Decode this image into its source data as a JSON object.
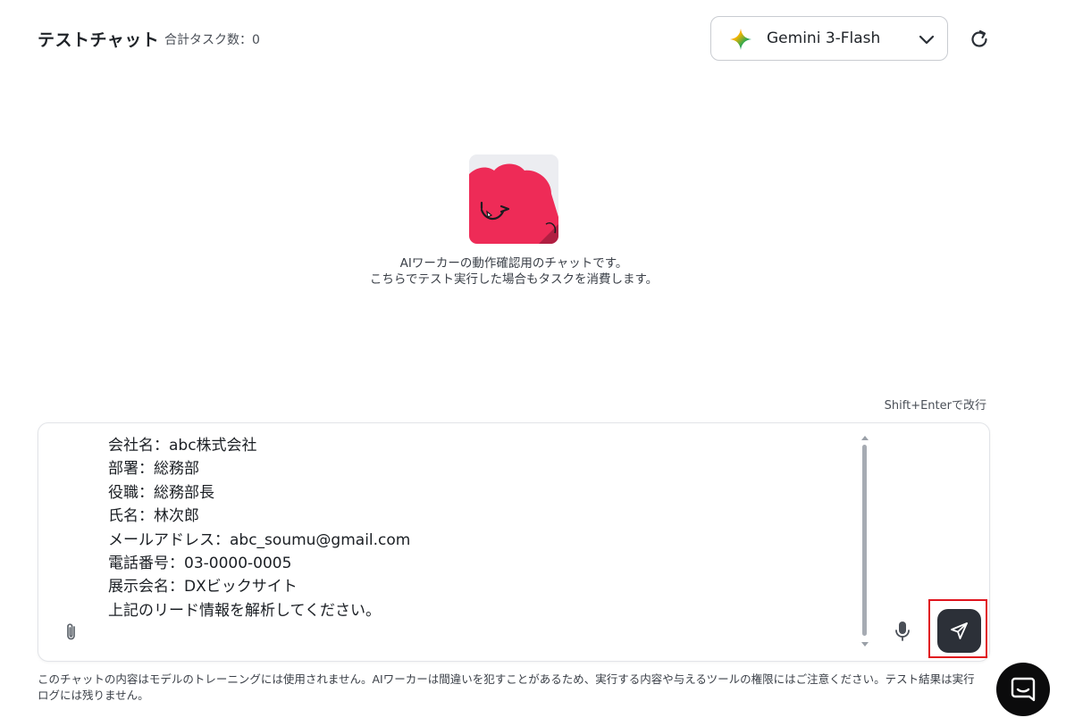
{
  "header": {
    "title": "テストチャット",
    "task_count": "合計タスク数：0"
  },
  "model_selector": {
    "selected": "Gemini 3-Flash",
    "icon": "gemini-sparkle-icon"
  },
  "intro": {
    "line1": "AIワーカーの動作確認用のチャットです。",
    "line2": "こちらでテスト実行した場合もタスクを消費します。"
  },
  "composer": {
    "hint": "Shift+Enterで改行",
    "message": "会社名：abc株式会社\n部署：総務部\n役職：総務部長\n氏名：林次郎\nメールアドレス：abc_soumu@gmail.com\n電話番号：03-0000-0005\n展示会名：DXビックサイト\n上記のリード情報を解析してください。"
  },
  "disclaimer": "このチャットの内容はモデルのトレーニングには使用されません。AIワーカーは間違いを犯すことがあるため、実行する内容や与えるツールの権限にはご注意ください。テスト結果は実行ログには残りません。",
  "colors": {
    "send_button": "#2c3038",
    "highlight": "#e0141e",
    "mascot": "#ee2b57"
  }
}
